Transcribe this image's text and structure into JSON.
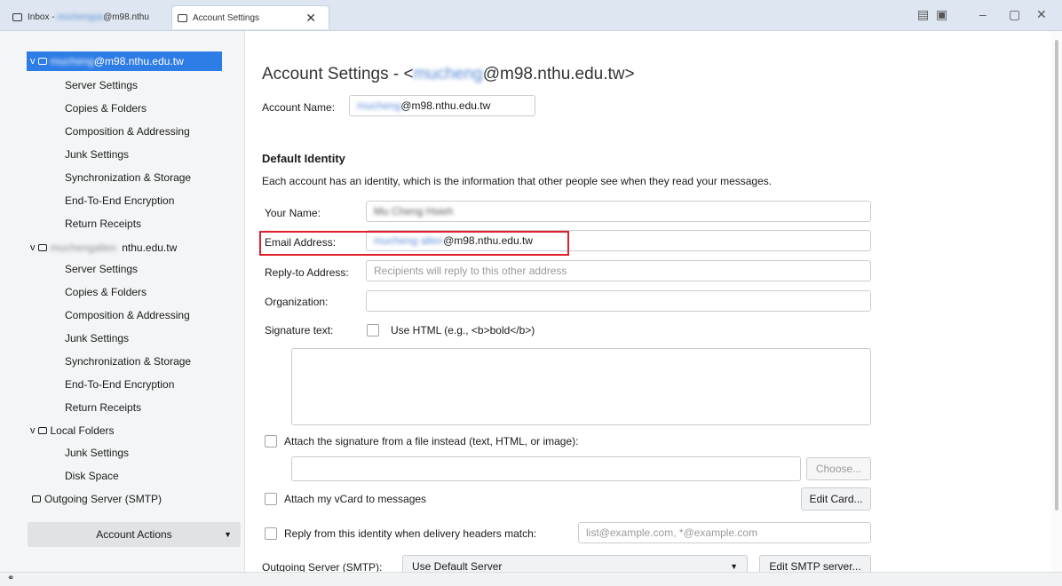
{
  "tabs": [
    {
      "label_prefix": "Inbox - ",
      "label_blur": "muchengya",
      "label_suffix": "@m98.nthu"
    },
    {
      "label": "Account Settings"
    }
  ],
  "sidebar": {
    "account1": {
      "blur": "mucheng",
      "domain": "@m98.nthu.edu.tw",
      "items": [
        "Server Settings",
        "Copies & Folders",
        "Composition & Addressing",
        "Junk Settings",
        "Synchronization & Storage",
        "End-To-End Encryption",
        "Return Receipts"
      ]
    },
    "account2": {
      "blur": "muchengallen",
      "domain": "nthu.edu.tw",
      "items": [
        "Server Settings",
        "Copies & Folders",
        "Composition & Addressing",
        "Junk Settings",
        "Synchronization & Storage",
        "End-To-End Encryption",
        "Return Receipts"
      ]
    },
    "local_folders": {
      "label": "Local Folders",
      "items": [
        "Junk Settings",
        "Disk Space"
      ]
    },
    "outgoing": "Outgoing Server (SMTP)",
    "account_actions": "Account Actions"
  },
  "main": {
    "title_prefix": "Account Settings - <",
    "title_blur": "mucheng",
    "title_suffix": "@m98.nthu.edu.tw>",
    "account_name_label": "Account Name:",
    "account_name_blur": "mucheng",
    "account_name_suffix": "@m98.nthu.edu.tw",
    "default_identity": "Default Identity",
    "identity_desc": "Each account has an identity, which is the information that other people see when they read your messages.",
    "your_name_label": "Your Name:",
    "your_name_blur": "Mu Cheng Hsieh",
    "email_label": "Email Address:",
    "email_blur": "mucheng allen",
    "email_suffix": "@m98.nthu.edu.tw",
    "reply_to_label": "Reply-to Address:",
    "reply_to_placeholder": "Recipients will reply to this other address",
    "organization_label": "Organization:",
    "signature_label": "Signature text:",
    "use_html_label": "Use HTML (e.g., <b>bold</b>)",
    "attach_sig_label": "Attach the signature from a file instead (text, HTML, or image):",
    "choose_button": "Choose...",
    "vcard_label": "Attach my vCard to messages",
    "edit_card_button": "Edit Card...",
    "reply_from_label": "Reply from this identity when delivery headers match:",
    "reply_from_placeholder": "list@example.com, *@example.com",
    "smtp_label": "Outgoing Server (SMTP):",
    "smtp_value": "Use Default Server",
    "edit_smtp_button": "Edit SMTP server..."
  },
  "colors": {
    "accent": "#2e7ce6",
    "highlight": "#e0202a"
  }
}
